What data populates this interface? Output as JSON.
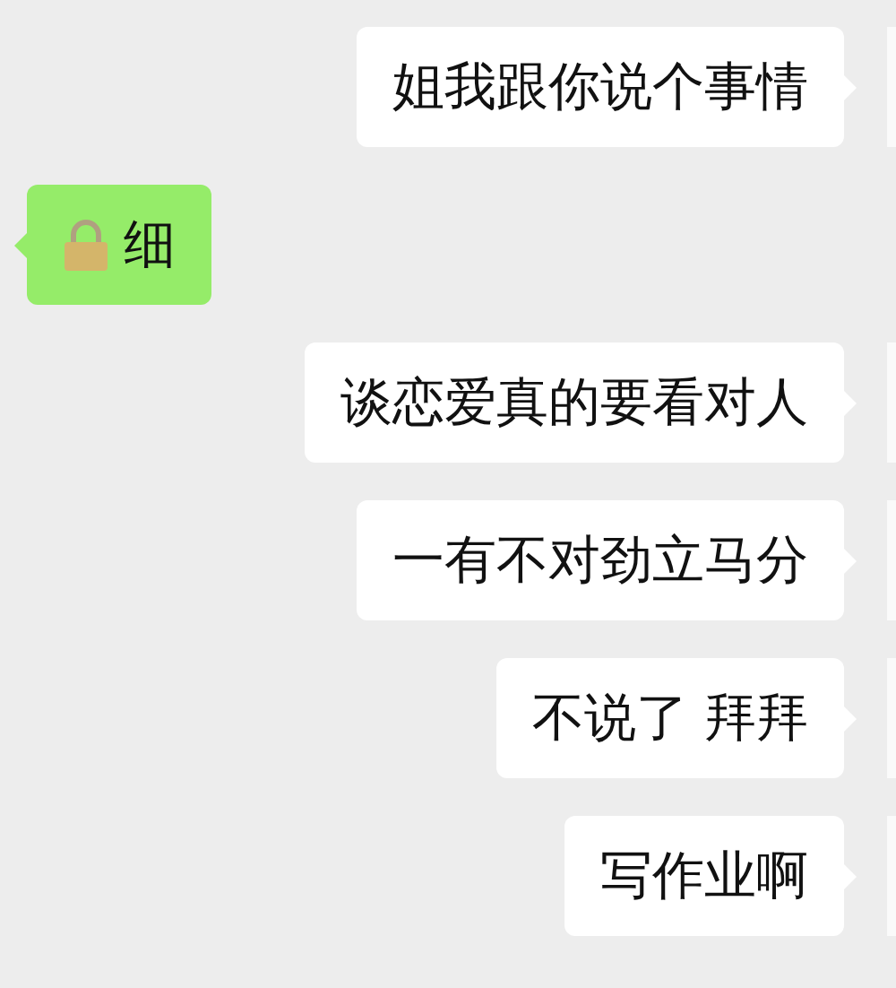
{
  "messages": [
    {
      "kind": "outgoing",
      "text": "姐我跟你说个事情"
    },
    {
      "kind": "incoming-lock",
      "text": "细"
    },
    {
      "kind": "outgoing",
      "text": "谈恋爱真的要看对人"
    },
    {
      "kind": "outgoing",
      "text": "一有不对劲立马分"
    },
    {
      "kind": "outgoing",
      "text": "不说了 拜拜"
    },
    {
      "kind": "outgoing",
      "text": "写作业啊"
    }
  ]
}
